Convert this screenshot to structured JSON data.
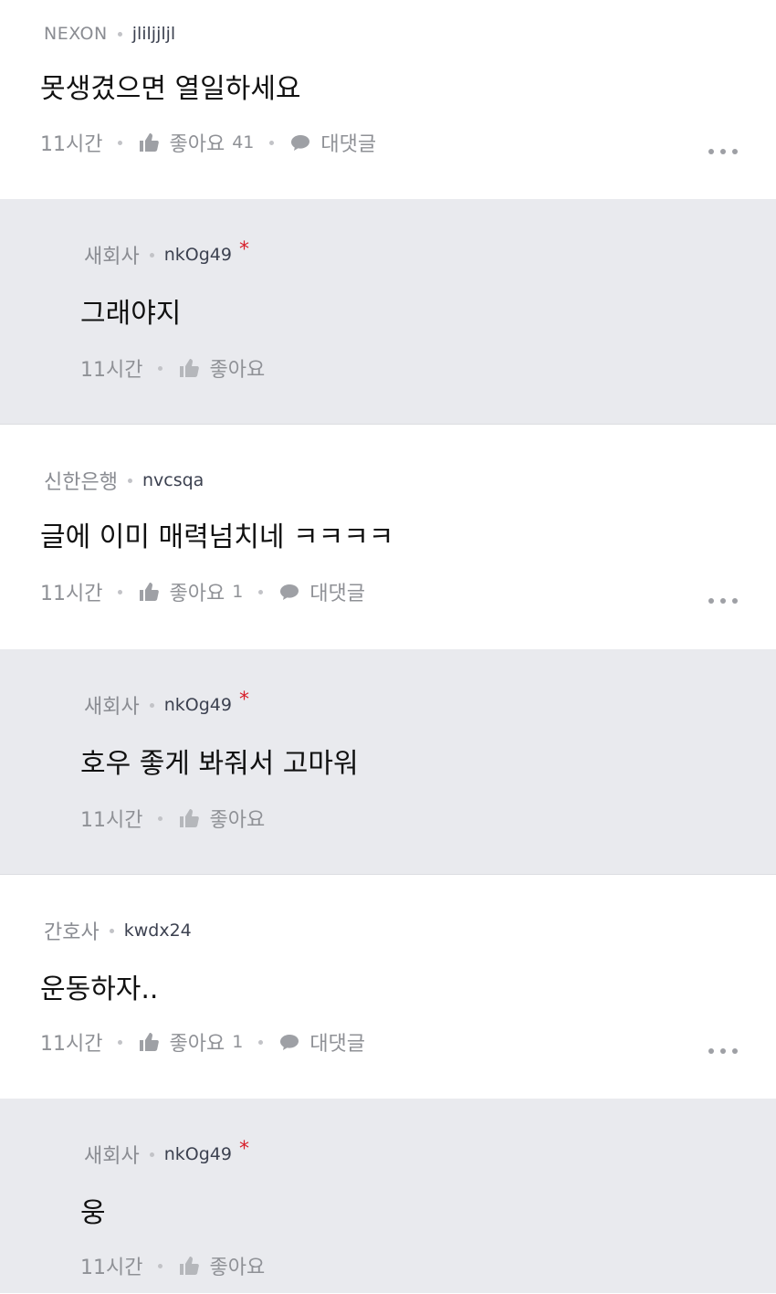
{
  "comments": [
    {
      "company": "NEXON",
      "nickname": "jliljjljl",
      "text": "못생겼으면 열일하세요",
      "time": "11시간",
      "like_label": "좋아요",
      "like_count": "41",
      "reply_label": "대댓글"
    },
    {
      "company": "새회사",
      "nickname": "nkOg49",
      "author_mark": "*",
      "text": "그래야지",
      "time": "11시간",
      "like_label": "좋아요"
    },
    {
      "company": "신한은행",
      "nickname": "nvcsqa",
      "text": "글에 이미 매력넘치네 ㅋㅋㅋㅋ",
      "time": "11시간",
      "like_label": "좋아요",
      "like_count": "1",
      "reply_label": "대댓글"
    },
    {
      "company": "새회사",
      "nickname": "nkOg49",
      "author_mark": "*",
      "text": "호우 좋게 봐줘서 고마워",
      "time": "11시간",
      "like_label": "좋아요"
    },
    {
      "company": "간호사",
      "nickname": "kwdx24",
      "text": "운동하자..",
      "time": "11시간",
      "like_label": "좋아요",
      "like_count": "1",
      "reply_label": "대댓글"
    },
    {
      "company": "새회사",
      "nickname": "nkOg49",
      "author_mark": "*",
      "text": "웅",
      "time": "11시간",
      "like_label": "좋아요"
    }
  ],
  "colors": {
    "reply_background": "#e9eaee",
    "author_mark": "#d81e2a",
    "muted_text": "#8f9196"
  },
  "icons": {
    "like": "thumbs-up-icon",
    "reply": "speech-bubble-icon",
    "more": "more-dots-icon"
  }
}
